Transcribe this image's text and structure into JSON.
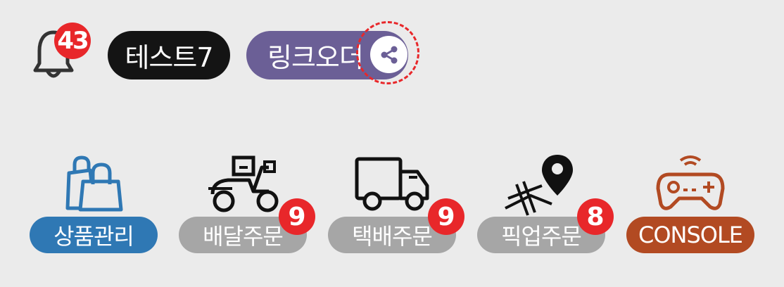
{
  "header": {
    "notification_count": "43",
    "store_name": "테스트7",
    "link_order_label": "링크오더"
  },
  "menu": [
    {
      "label": "상품관리",
      "icon": "shopping-bags-icon",
      "color": "#2f78b4",
      "badge": ""
    },
    {
      "label": "배달주문",
      "icon": "delivery-scooter-icon",
      "color": "#a6a6a6",
      "badge": "9"
    },
    {
      "label": "택배주문",
      "icon": "delivery-truck-icon",
      "color": "#a6a6a6",
      "badge": "9"
    },
    {
      "label": "픽업주문",
      "icon": "map-pin-icon",
      "color": "#a6a6a6",
      "badge": "8"
    },
    {
      "label": "CONSOLE",
      "icon": "gamepad-icon",
      "color": "#b24a22",
      "badge": ""
    }
  ],
  "colors": {
    "background": "#ebebeb",
    "badge_red": "#e8272a",
    "link_pill": "#6b5f96",
    "store_pill": "#141414"
  }
}
